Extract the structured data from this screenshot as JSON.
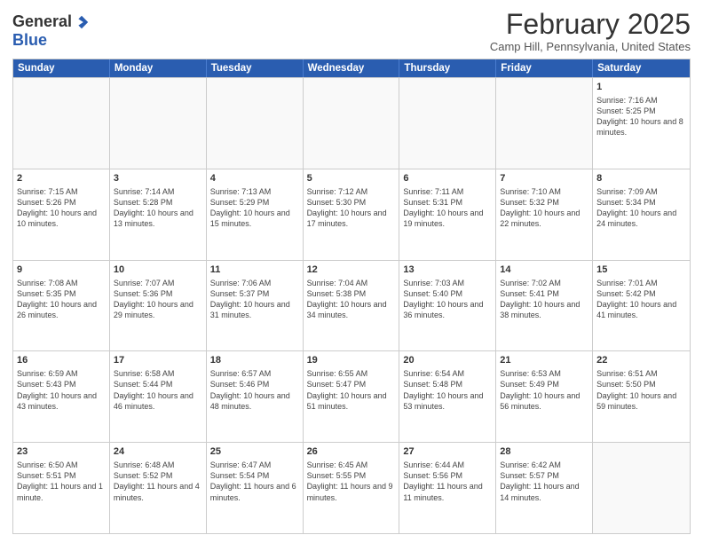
{
  "header": {
    "logo_general": "General",
    "logo_blue": "Blue",
    "month_title": "February 2025",
    "location": "Camp Hill, Pennsylvania, United States"
  },
  "weekdays": [
    "Sunday",
    "Monday",
    "Tuesday",
    "Wednesday",
    "Thursday",
    "Friday",
    "Saturday"
  ],
  "rows": [
    [
      {
        "day": "",
        "info": ""
      },
      {
        "day": "",
        "info": ""
      },
      {
        "day": "",
        "info": ""
      },
      {
        "day": "",
        "info": ""
      },
      {
        "day": "",
        "info": ""
      },
      {
        "day": "",
        "info": ""
      },
      {
        "day": "1",
        "info": "Sunrise: 7:16 AM\nSunset: 5:25 PM\nDaylight: 10 hours and 8 minutes."
      }
    ],
    [
      {
        "day": "2",
        "info": "Sunrise: 7:15 AM\nSunset: 5:26 PM\nDaylight: 10 hours and 10 minutes."
      },
      {
        "day": "3",
        "info": "Sunrise: 7:14 AM\nSunset: 5:28 PM\nDaylight: 10 hours and 13 minutes."
      },
      {
        "day": "4",
        "info": "Sunrise: 7:13 AM\nSunset: 5:29 PM\nDaylight: 10 hours and 15 minutes."
      },
      {
        "day": "5",
        "info": "Sunrise: 7:12 AM\nSunset: 5:30 PM\nDaylight: 10 hours and 17 minutes."
      },
      {
        "day": "6",
        "info": "Sunrise: 7:11 AM\nSunset: 5:31 PM\nDaylight: 10 hours and 19 minutes."
      },
      {
        "day": "7",
        "info": "Sunrise: 7:10 AM\nSunset: 5:32 PM\nDaylight: 10 hours and 22 minutes."
      },
      {
        "day": "8",
        "info": "Sunrise: 7:09 AM\nSunset: 5:34 PM\nDaylight: 10 hours and 24 minutes."
      }
    ],
    [
      {
        "day": "9",
        "info": "Sunrise: 7:08 AM\nSunset: 5:35 PM\nDaylight: 10 hours and 26 minutes."
      },
      {
        "day": "10",
        "info": "Sunrise: 7:07 AM\nSunset: 5:36 PM\nDaylight: 10 hours and 29 minutes."
      },
      {
        "day": "11",
        "info": "Sunrise: 7:06 AM\nSunset: 5:37 PM\nDaylight: 10 hours and 31 minutes."
      },
      {
        "day": "12",
        "info": "Sunrise: 7:04 AM\nSunset: 5:38 PM\nDaylight: 10 hours and 34 minutes."
      },
      {
        "day": "13",
        "info": "Sunrise: 7:03 AM\nSunset: 5:40 PM\nDaylight: 10 hours and 36 minutes."
      },
      {
        "day": "14",
        "info": "Sunrise: 7:02 AM\nSunset: 5:41 PM\nDaylight: 10 hours and 38 minutes."
      },
      {
        "day": "15",
        "info": "Sunrise: 7:01 AM\nSunset: 5:42 PM\nDaylight: 10 hours and 41 minutes."
      }
    ],
    [
      {
        "day": "16",
        "info": "Sunrise: 6:59 AM\nSunset: 5:43 PM\nDaylight: 10 hours and 43 minutes."
      },
      {
        "day": "17",
        "info": "Sunrise: 6:58 AM\nSunset: 5:44 PM\nDaylight: 10 hours and 46 minutes."
      },
      {
        "day": "18",
        "info": "Sunrise: 6:57 AM\nSunset: 5:46 PM\nDaylight: 10 hours and 48 minutes."
      },
      {
        "day": "19",
        "info": "Sunrise: 6:55 AM\nSunset: 5:47 PM\nDaylight: 10 hours and 51 minutes."
      },
      {
        "day": "20",
        "info": "Sunrise: 6:54 AM\nSunset: 5:48 PM\nDaylight: 10 hours and 53 minutes."
      },
      {
        "day": "21",
        "info": "Sunrise: 6:53 AM\nSunset: 5:49 PM\nDaylight: 10 hours and 56 minutes."
      },
      {
        "day": "22",
        "info": "Sunrise: 6:51 AM\nSunset: 5:50 PM\nDaylight: 10 hours and 59 minutes."
      }
    ],
    [
      {
        "day": "23",
        "info": "Sunrise: 6:50 AM\nSunset: 5:51 PM\nDaylight: 11 hours and 1 minute."
      },
      {
        "day": "24",
        "info": "Sunrise: 6:48 AM\nSunset: 5:52 PM\nDaylight: 11 hours and 4 minutes."
      },
      {
        "day": "25",
        "info": "Sunrise: 6:47 AM\nSunset: 5:54 PM\nDaylight: 11 hours and 6 minutes."
      },
      {
        "day": "26",
        "info": "Sunrise: 6:45 AM\nSunset: 5:55 PM\nDaylight: 11 hours and 9 minutes."
      },
      {
        "day": "27",
        "info": "Sunrise: 6:44 AM\nSunset: 5:56 PM\nDaylight: 11 hours and 11 minutes."
      },
      {
        "day": "28",
        "info": "Sunrise: 6:42 AM\nSunset: 5:57 PM\nDaylight: 11 hours and 14 minutes."
      },
      {
        "day": "",
        "info": ""
      }
    ]
  ]
}
